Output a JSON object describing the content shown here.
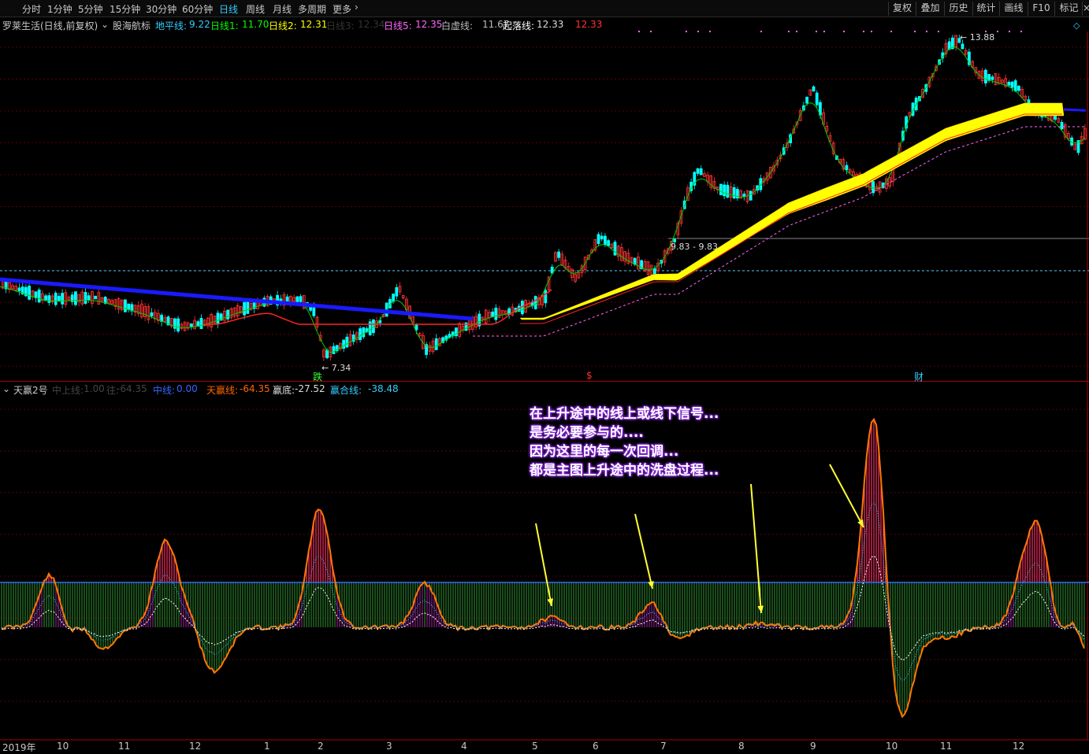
{
  "toolbar": {
    "periods": [
      "分时",
      "1分钟",
      "5分钟",
      "15分钟",
      "30分钟",
      "60分钟",
      "日线",
      "周线",
      "月线",
      "多周期",
      "更多"
    ],
    "active_period": "日线",
    "right_buttons": [
      "复权",
      "叠加",
      "历史",
      "统计",
      "画线",
      "F10",
      "标记"
    ]
  },
  "main_info": {
    "stock": "罗莱生活(日线,前复权)",
    "indicator": "股海航标",
    "items": [
      {
        "label": "地平线:",
        "value": "9.22",
        "color": "#33ccff"
      },
      {
        "label": "日线1:",
        "value": "11.70",
        "color": "#00ff00"
      },
      {
        "label": "日线2:",
        "value": "12.31",
        "color": "#ffff00"
      },
      {
        "label": "日线3:",
        "value": "12.34",
        "color": "#333333"
      },
      {
        "label": "日线5:",
        "value": "12.35",
        "color": "#ff66ff"
      },
      {
        "label": "白虚线:",
        "value": "11.67",
        "color": "#bbbbbb"
      },
      {
        "label": "起落线:",
        "value": "12.33",
        "color": "#ffffff"
      },
      {
        "label": "",
        "value": "12.33",
        "color": "#ff3333"
      }
    ],
    "price_labels": {
      "high": "13.88",
      "low": "7.34",
      "range": "9.83 - 9.83"
    },
    "markers": [
      {
        "text": "跌",
        "color": "#33ff33"
      },
      {
        "text": "$",
        "color": "#ff3333"
      },
      {
        "text": "财",
        "color": "#33ccff"
      }
    ]
  },
  "sub_info": {
    "name": "天赢2号",
    "items": [
      {
        "label": "中上线:",
        "value": "1.00",
        "color": "#444444"
      },
      {
        "label": "往:",
        "value": "-64.35",
        "color": "#444444"
      },
      {
        "label": "中线:",
        "value": "0.00",
        "color": "#3366ff"
      },
      {
        "label": "天赢线:",
        "value": "-64.35",
        "color": "#ff6600"
      },
      {
        "label": "赢底:",
        "value": "-27.52",
        "color": "#dddddd"
      },
      {
        "label": "赢合线:",
        "value": "-38.48",
        "color": "#33ccff"
      }
    ]
  },
  "annotation": [
    "在上升途中的线上或线下信号...",
    "是务必要参与的....",
    "因为这里的每一次回调...",
    "都是主图上升途中的洗盘过程..."
  ],
  "x_axis": [
    "2019年",
    "10",
    "11",
    "12",
    "1",
    "2",
    "3",
    "4",
    "5",
    "6",
    "7",
    "8",
    "9",
    "10",
    "11",
    "12"
  ],
  "colors": {
    "up": "#ff3333",
    "down": "#00ffff",
    "bull_bar": "#ff3366",
    "bear_bar": "#339933",
    "ribbon": "#ffff00",
    "avg_blue": "#1a1aff"
  }
}
